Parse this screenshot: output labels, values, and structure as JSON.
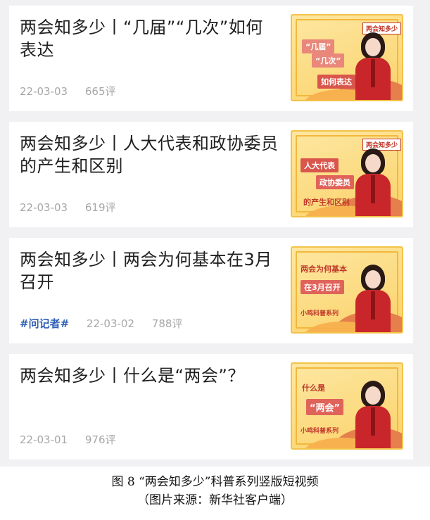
{
  "feed": {
    "items": [
      {
        "title": "两会知多少丨“几届”“几次”如何表达",
        "date": "22-03-03",
        "comments": "665评",
        "thumb": {
          "badge": "两会知多少",
          "lines": [
            "“几届”",
            "“几次”",
            "如何表达"
          ]
        }
      },
      {
        "title": "两会知多少丨人大代表和政协委员的产生和区别",
        "date": "22-03-03",
        "comments": "619评",
        "thumb": {
          "badge": "两会知多少",
          "lines": [
            "人大代表",
            "政协委员",
            "的产生和区别"
          ]
        }
      },
      {
        "title": "两会知多少丨两会为何基本在3月召开",
        "tag": "#问记者#",
        "date": "22-03-02",
        "comments": "788评",
        "thumb": {
          "lines": [
            "两会为何基本",
            "在3月召开",
            "小鸣科普系列"
          ]
        }
      },
      {
        "title": "两会知多少丨什么是“两会”？",
        "date": "22-03-01",
        "comments": "976评",
        "thumb": {
          "lines": [
            "什么是",
            "“两会”",
            "小鸣科普系列"
          ]
        }
      }
    ]
  },
  "caption": {
    "line1": "图 8 “两会知多少”科普系列竖版短视频",
    "line2": "（图片来源：新华社客户端）"
  },
  "colors": {
    "background": "#f1f1f3",
    "card": "#ffffff",
    "title": "#1f1f1f",
    "meta": "#a7a7a7",
    "tag": "#2f5fb3",
    "thumb_yellow": "#fbd26a",
    "thumb_red": "#c8262a"
  }
}
